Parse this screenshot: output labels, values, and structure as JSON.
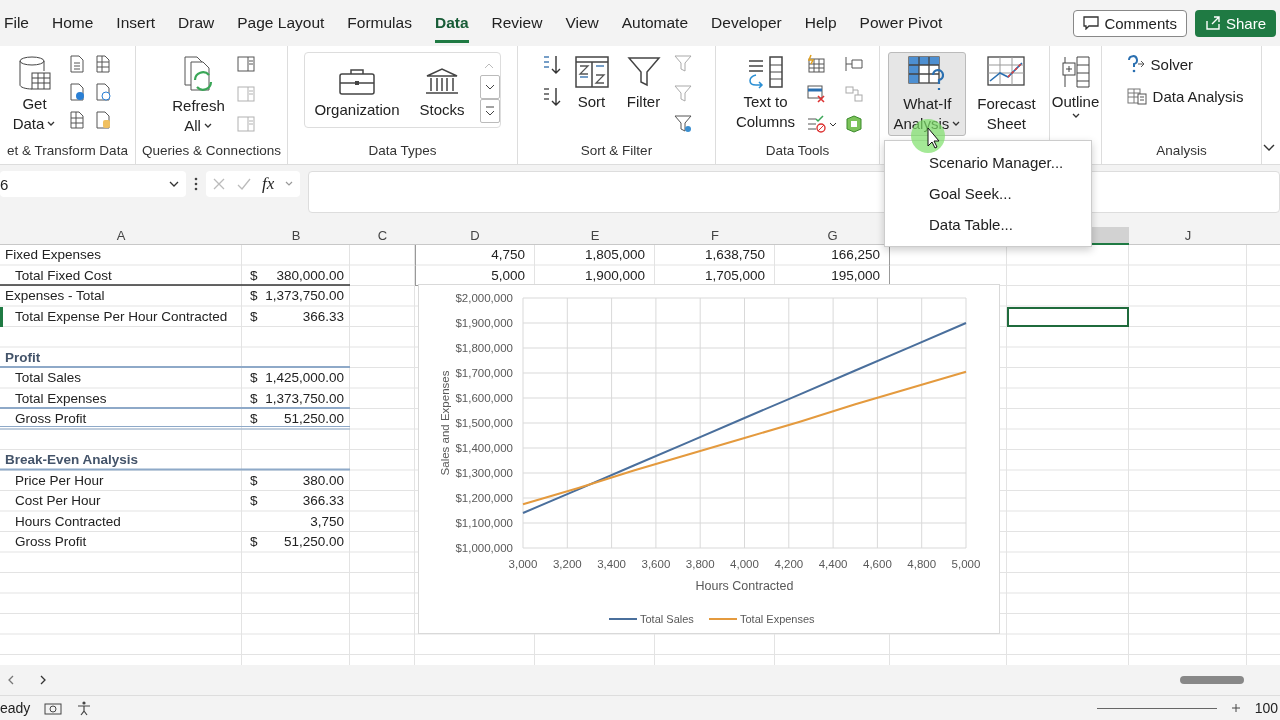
{
  "ribbon_tabs": [
    {
      "label": "File",
      "selected": false
    },
    {
      "label": "Home",
      "selected": false
    },
    {
      "label": "Insert",
      "selected": false
    },
    {
      "label": "Draw",
      "selected": false
    },
    {
      "label": "Page Layout",
      "selected": false
    },
    {
      "label": "Formulas",
      "selected": false
    },
    {
      "label": "Data",
      "selected": true
    },
    {
      "label": "Review",
      "selected": false
    },
    {
      "label": "View",
      "selected": false
    },
    {
      "label": "Automate",
      "selected": false
    },
    {
      "label": "Developer",
      "selected": false
    },
    {
      "label": "Help",
      "selected": false
    },
    {
      "label": "Power Pivot",
      "selected": false
    }
  ],
  "comments_button": "Comments",
  "share_button": "Share",
  "ribbon_groups": [
    {
      "kind": "get-transform",
      "label": "et & Transform Data",
      "buttons": [
        {
          "lines": [
            "Get",
            "Data"
          ],
          "dropdown": true,
          "expanded": false
        }
      ]
    },
    {
      "kind": "queries",
      "label": "Queries & Connections",
      "buttons": [
        {
          "lines": [
            "Refresh",
            "All"
          ],
          "dropdown": true,
          "expanded": false
        }
      ]
    },
    {
      "kind": "data-types",
      "label": "Data Types",
      "buttons": [
        {
          "lines": [
            "Organization"
          ],
          "dropdown": false,
          "expanded": false
        },
        {
          "lines": [
            "Stocks"
          ],
          "dropdown": false,
          "expanded": false
        }
      ]
    },
    {
      "kind": "sort-filter",
      "label": "Sort & Filter",
      "buttons": [
        {
          "lines": [
            "Sort"
          ],
          "dropdown": false,
          "expanded": false
        },
        {
          "lines": [
            "Filter"
          ],
          "dropdown": false,
          "expanded": false
        }
      ]
    },
    {
      "kind": "data-tools",
      "label": "Data Tools",
      "buttons": [
        {
          "lines": [
            "Text to",
            "Columns"
          ],
          "dropdown": false,
          "expanded": false
        }
      ]
    },
    {
      "kind": "forecast",
      "buttons": [
        {
          "lines": [
            "What-If",
            "Analysis"
          ],
          "dropdown": true,
          "expanded": true
        },
        {
          "lines": [
            "Forecast",
            "Sheet"
          ],
          "dropdown": false,
          "expanded": false
        }
      ]
    },
    {
      "kind": "outline",
      "buttons": [
        {
          "lines": [
            "Outline"
          ],
          "dropdown": true,
          "expanded": false
        }
      ]
    },
    {
      "kind": "analysis",
      "label": "Analysis",
      "buttons": [
        {
          "lines": [
            "Solver"
          ],
          "dropdown": false,
          "expanded": false
        },
        {
          "lines": [
            "Data Analysis"
          ],
          "dropdown": false,
          "expanded": false
        }
      ]
    }
  ],
  "menu": {
    "items": [
      "Scenario Manager...",
      "Goal Seek...",
      "Data Table..."
    ]
  },
  "formula_bar": {
    "name_box": "6",
    "fx": "fx"
  },
  "columns": [
    {
      "label": "A",
      "selected": false
    },
    {
      "label": "B",
      "selected": false
    },
    {
      "label": "C",
      "selected": false
    },
    {
      "label": "D",
      "selected": false
    },
    {
      "label": "E",
      "selected": false
    },
    {
      "label": "F",
      "selected": false
    },
    {
      "label": "G",
      "selected": false
    },
    {
      "label": "J",
      "selected": false
    }
  ],
  "active_column_header": {
    "selected": true
  },
  "rows": [
    {
      "kind": "section",
      "label": "Fixed Expenses",
      "table": [
        "4,750",
        "1,805,000",
        "1,638,750",
        "166,250"
      ],
      "selected": false
    },
    {
      "kind": "item",
      "label": "Total Fixed Cost",
      "currency": "$",
      "amount": "380,000.00",
      "dark_rule": true,
      "table": [
        "5,000",
        "1,900,000",
        "1,705,000",
        "195,000"
      ],
      "selected": false
    },
    {
      "kind": "section",
      "label": "Expenses - Total",
      "currency": "$",
      "amount": "1,373,750.00",
      "selected": false
    },
    {
      "kind": "item",
      "label": "Total Expense Per Hour Contracted",
      "currency": "$",
      "amount": "366.33",
      "selected": true
    },
    {
      "selected": false
    },
    {
      "kind": "heading",
      "label": "Profit",
      "blue_rule": true,
      "selected": false
    },
    {
      "kind": "item",
      "label": "Total Sales",
      "currency": "$",
      "amount": "1,425,000.00",
      "selected": false
    },
    {
      "kind": "item",
      "label": "Total Expenses",
      "currency": "$",
      "amount": "1,373,750.00",
      "blue_rule": true,
      "selected": false
    },
    {
      "kind": "item",
      "label": "Gross Profit",
      "currency": "$",
      "amount": "51,250.00",
      "double_rule": true,
      "selected": false
    },
    {
      "selected": false
    },
    {
      "kind": "heading",
      "label": "Break-Even Analysis",
      "blue_rule": true,
      "selected": false
    },
    {
      "kind": "item",
      "label": "Price Per Hour",
      "currency": "$",
      "amount": "380.00",
      "selected": false
    },
    {
      "kind": "item",
      "label": "Cost Per Hour",
      "currency": "$",
      "amount": "366.33",
      "selected": false
    },
    {
      "kind": "item",
      "label": "Hours Contracted",
      "amount": "3,750",
      "selected": false
    },
    {
      "kind": "item",
      "label": "Gross Profit",
      "currency": "$",
      "amount": "51,250.00",
      "selected": false
    }
  ],
  "chart_data": {
    "type": "line",
    "xlabel": "Hours Contracted",
    "ylabel": "Sales and Expenses",
    "grid": true,
    "legend": "bottom",
    "x": [
      3000,
      3250,
      3500,
      3750,
      4000,
      4250,
      4500,
      4750,
      5000
    ],
    "series": [
      {
        "name": "Total Sales",
        "color": "#4a6f9c",
        "values": [
          1140000,
          1235000,
          1330000,
          1425000,
          1520000,
          1615000,
          1710000,
          1805000,
          1900000
        ]
      },
      {
        "name": "Total Expenses",
        "color": "#e49a3e",
        "values": [
          1175000,
          1240000,
          1310000,
          1375000,
          1440000,
          1505000,
          1575000,
          1640000,
          1705000
        ]
      }
    ],
    "xlim": [
      3000,
      5000
    ],
    "ylim": [
      1000000,
      2000000
    ],
    "xticks": [
      {
        "value": 3000,
        "label": "3,000"
      },
      {
        "value": 3200,
        "label": "3,200"
      },
      {
        "value": 3400,
        "label": "3,400"
      },
      {
        "value": 3600,
        "label": "3,600"
      },
      {
        "value": 3800,
        "label": "3,800"
      },
      {
        "value": 4000,
        "label": "4,000"
      },
      {
        "value": 4200,
        "label": "4,200"
      },
      {
        "value": 4400,
        "label": "4,400"
      },
      {
        "value": 4600,
        "label": "4,600"
      },
      {
        "value": 4800,
        "label": "4,800"
      },
      {
        "value": 5000,
        "label": "5,000"
      }
    ],
    "yticks": [
      {
        "value": 1000000,
        "label": "$1,000,000"
      },
      {
        "value": 1100000,
        "label": "$1,100,000"
      },
      {
        "value": 1200000,
        "label": "$1,200,000"
      },
      {
        "value": 1300000,
        "label": "$1,300,000"
      },
      {
        "value": 1400000,
        "label": "$1,400,000"
      },
      {
        "value": 1500000,
        "label": "$1,500,000"
      },
      {
        "value": 1600000,
        "label": "$1,600,000"
      },
      {
        "value": 1700000,
        "label": "$1,700,000"
      },
      {
        "value": 1800000,
        "label": "$1,800,000"
      },
      {
        "value": 1900000,
        "label": "$1,900,000"
      },
      {
        "value": 2000000,
        "label": "$2,000,000"
      }
    ]
  },
  "status_bar": {
    "status": "eady",
    "zoom": "100"
  }
}
